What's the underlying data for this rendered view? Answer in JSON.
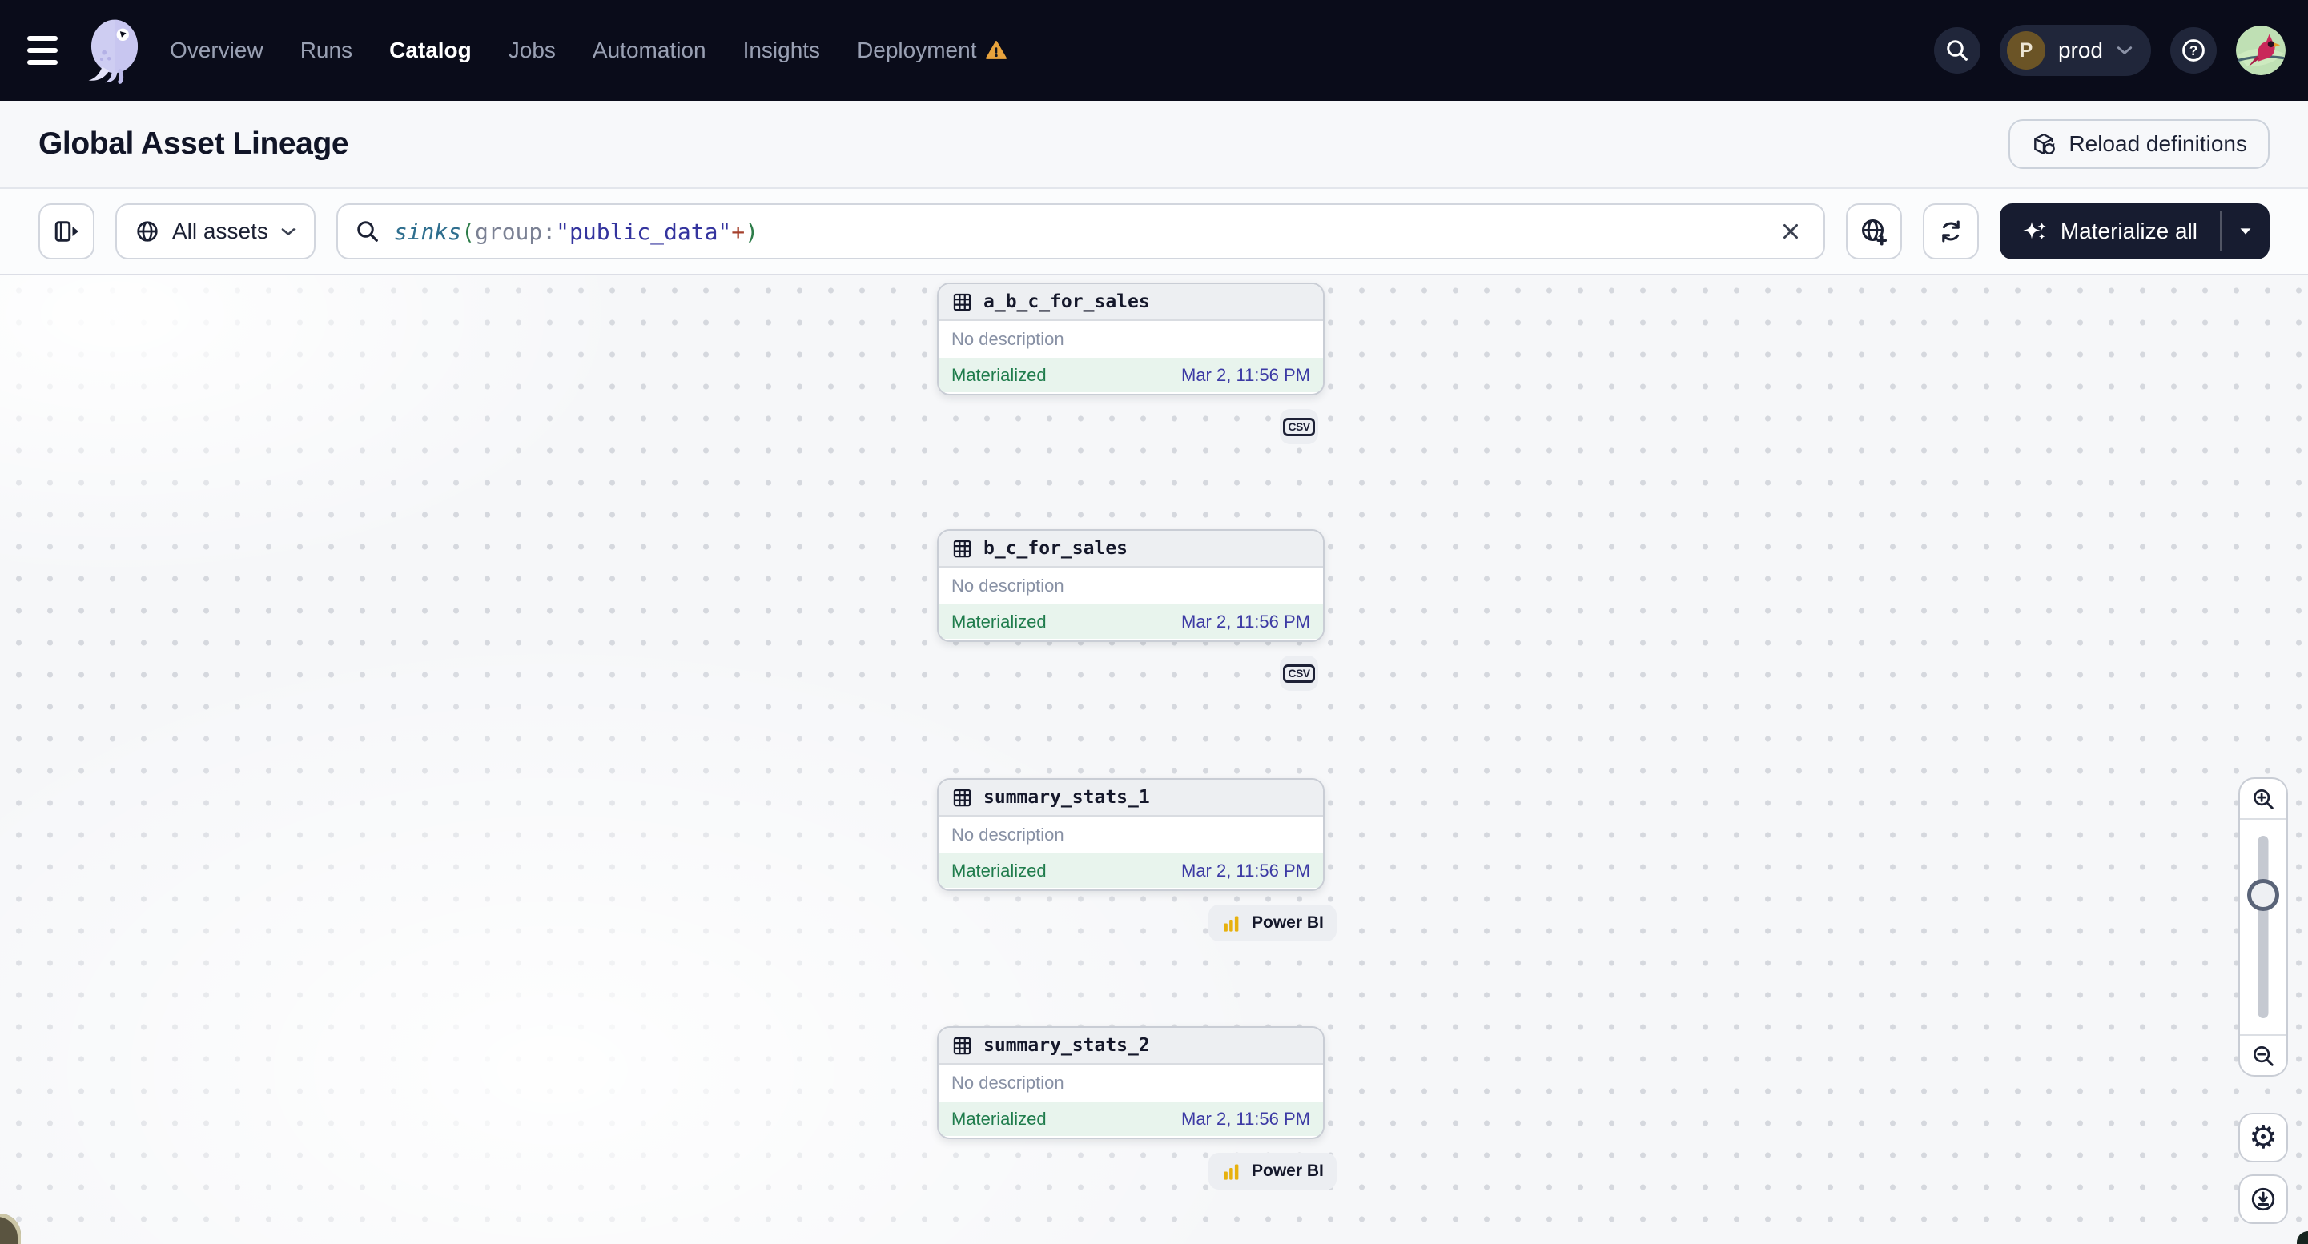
{
  "colors": {
    "nav_bg": "#0a0c1a",
    "accent_dark_button": "#171c30",
    "status_green": "#1f7c4c",
    "status_green_bg": "#e8f4ed",
    "timestamp_indigo": "#3c3aa4",
    "warning_amber": "#e8a33d",
    "query_function": "#2e6e8e",
    "query_paren": "#2e7d4a",
    "query_attribute": "#7b8194",
    "query_string": "#34349e",
    "query_plus": "#a5402c",
    "powerbi_yellow": "#e7b10e",
    "wedge_left": "#5a5440",
    "wedge_right": "#16241f"
  },
  "nav": {
    "items": [
      {
        "label": "Overview",
        "active": false,
        "warning": false
      },
      {
        "label": "Runs",
        "active": false,
        "warning": false
      },
      {
        "label": "Catalog",
        "active": true,
        "warning": false
      },
      {
        "label": "Jobs",
        "active": false,
        "warning": false
      },
      {
        "label": "Automation",
        "active": false,
        "warning": false
      },
      {
        "label": "Insights",
        "active": false,
        "warning": false
      },
      {
        "label": "Deployment",
        "active": false,
        "warning": true
      }
    ],
    "environment": {
      "initial": "P",
      "name": "prod"
    }
  },
  "header": {
    "title": "Global Asset Lineage",
    "reload_label": "Reload definitions"
  },
  "toolbar": {
    "scope_label": "All assets",
    "query": {
      "segments": [
        {
          "text": "sinks",
          "style": "fn"
        },
        {
          "text": "(",
          "style": "paren"
        },
        {
          "text": "group",
          "style": "attr"
        },
        {
          "text": ":",
          "style": "attr"
        },
        {
          "text": "\"public_data\"",
          "style": "str"
        },
        {
          "text": "+",
          "style": "plus"
        },
        {
          "text": ")",
          "style": "paren"
        }
      ]
    },
    "materialize_label": "Materialize all"
  },
  "canvas": {
    "cards": [
      {
        "name": "a_b_c_for_sales",
        "description": "No description",
        "status": "Materialized",
        "timestamp": "Mar 2, 11:56 PM",
        "kind": "csv",
        "kind_label": "CSV"
      },
      {
        "name": "b_c_for_sales",
        "description": "No description",
        "status": "Materialized",
        "timestamp": "Mar 2, 11:56 PM",
        "kind": "csv",
        "kind_label": "CSV"
      },
      {
        "name": "summary_stats_1",
        "description": "No description",
        "status": "Materialized",
        "timestamp": "Mar 2, 11:56 PM",
        "kind": "powerbi",
        "kind_label": "Power BI"
      },
      {
        "name": "summary_stats_2",
        "description": "No description",
        "status": "Materialized",
        "timestamp": "Mar 2, 11:56 PM",
        "kind": "powerbi",
        "kind_label": "Power BI"
      }
    ],
    "zoom_controls": {
      "slider_thumb_position_percent_from_top": 32
    }
  }
}
